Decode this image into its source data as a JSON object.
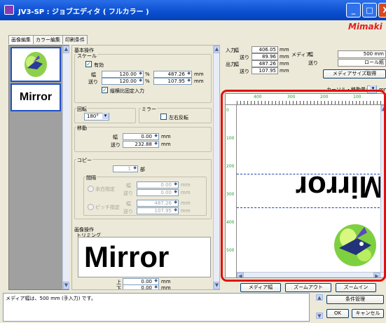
{
  "window": {
    "title": "JV3-SP : ジョブエディタ ( フルカラー )",
    "brand": "Mimaki",
    "brand_color": "#e0201e",
    "titlebar_color": "#0a4ed0"
  },
  "tabs": [
    "画像編集",
    "カラー編集",
    "印刷条件"
  ],
  "thumbnails": {
    "mirror_label": "Mirror"
  },
  "basic": {
    "header": "基本操作",
    "scale": {
      "title": "スケール",
      "enabled_label": "有効",
      "enabled": true,
      "width_label": "幅",
      "feed_label": "送り",
      "width_pct": "120.00",
      "feed_pct": "120.00",
      "pct_unit": "%",
      "width_mm": "487.26",
      "feed_mm": "107.95",
      "mm_unit": "mm",
      "lock_label": "縦横比固定入力",
      "lock": true
    },
    "rotate": {
      "title": "回転",
      "value": "180°"
    },
    "mirror": {
      "title": "ミラー",
      "lr_label": "左右反転",
      "lr": false
    },
    "move": {
      "title": "移動",
      "width_label": "幅",
      "feed_label": "送り",
      "width": "0.00",
      "feed": "232.88",
      "unit": "mm"
    },
    "copy": {
      "title": "コピー",
      "count": "1",
      "count_unit": "部",
      "interval_title": "間隔",
      "auto_label": "余白指定",
      "pitch_label": "ピッチ指定",
      "width_label": "幅",
      "feed_label": "送り",
      "auto_width": "0.00",
      "auto_feed": "0.00",
      "pitch_width": "487.26",
      "pitch_feed": "107.95",
      "unit": "mm"
    }
  },
  "image_ops": {
    "header": "画像操作",
    "trim_title": "トリミング",
    "trim_preview_text": "Mirror",
    "top_label": "上",
    "bottom_label": "下",
    "top": "0.00",
    "bottom": "0.00",
    "unit": "mm"
  },
  "info": {
    "input_label": "入力",
    "output_label": "出力",
    "width_label": "幅",
    "feed_label": "送り",
    "input_width": "406.05",
    "input_feed": "89.96",
    "output_width": "487.26",
    "output_feed": "107.95",
    "unit": "mm",
    "media_label": "メディア",
    "media_width_label": "幅",
    "media_feed_label": "送り",
    "media_width": "500 mm",
    "media_feed": "ロール紙",
    "get_media_button": "メディアサイズ取得",
    "cursor_label": "カーソル・移動量:",
    "cursor_value": "1",
    "cursor_unit": "mm"
  },
  "preview": {
    "top_ticks": [
      "400",
      "300",
      "200",
      "100"
    ],
    "left_ticks": [
      "0",
      "100",
      "200",
      "300",
      "400",
      "500"
    ],
    "text": "Mirror"
  },
  "bottom_buttons": {
    "media_width": "メディア幅",
    "zoom_out": "ズームアウト",
    "zoom_in": "ズームイン"
  },
  "status": {
    "message": "メディア幅は、500 mm (手入力) です。"
  },
  "footer_buttons": {
    "conditions": "条件管理",
    "ok": "OK",
    "cancel": "キャンセル"
  }
}
